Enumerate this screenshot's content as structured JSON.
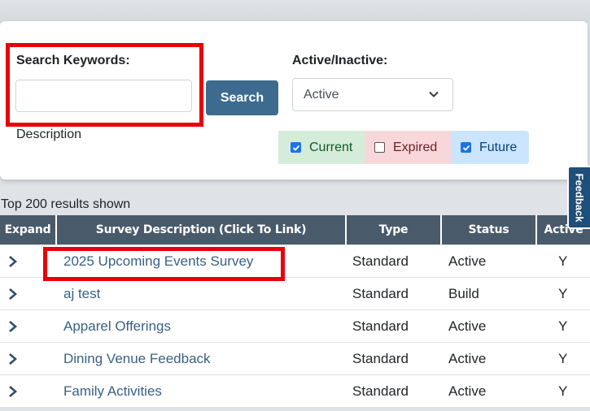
{
  "filters": {
    "search_label": "Search Keywords:",
    "search_value": "",
    "search_button": "Search",
    "description_label": "Description",
    "active_label": "Active/Inactive:",
    "active_selected": "Active",
    "checkboxes": [
      {
        "label": "Current",
        "checked": true,
        "bg": "#d4edda",
        "color": "#155724"
      },
      {
        "label": "Expired",
        "checked": false,
        "bg": "#f8d7da",
        "color": "#721c24"
      },
      {
        "label": "Future",
        "checked": true,
        "bg": "#cce5ff",
        "color": "#004085"
      }
    ]
  },
  "results_note": "Top 200 results shown",
  "table": {
    "headers": [
      "Expand",
      "Survey Description (Click To Link)",
      "Type",
      "Status",
      "Active"
    ],
    "rows": [
      {
        "description": "2025 Upcoming Events Survey",
        "type": "Standard",
        "status": "Active",
        "active": "Y"
      },
      {
        "description": "aj test",
        "type": "Standard",
        "status": "Build",
        "active": "Y"
      },
      {
        "description": "Apparel Offerings",
        "type": "Standard",
        "status": "Active",
        "active": "Y"
      },
      {
        "description": "Dining Venue Feedback",
        "type": "Standard",
        "status": "Active",
        "active": "Y"
      },
      {
        "description": "Family Activities",
        "type": "Standard",
        "status": "Active",
        "active": "Y"
      }
    ]
  },
  "feedback_tab": "Feedback",
  "colors": {
    "button": "#3c6b8f",
    "header": "#495a6b",
    "highlight": "#e8000b",
    "link": "#3a6086"
  }
}
